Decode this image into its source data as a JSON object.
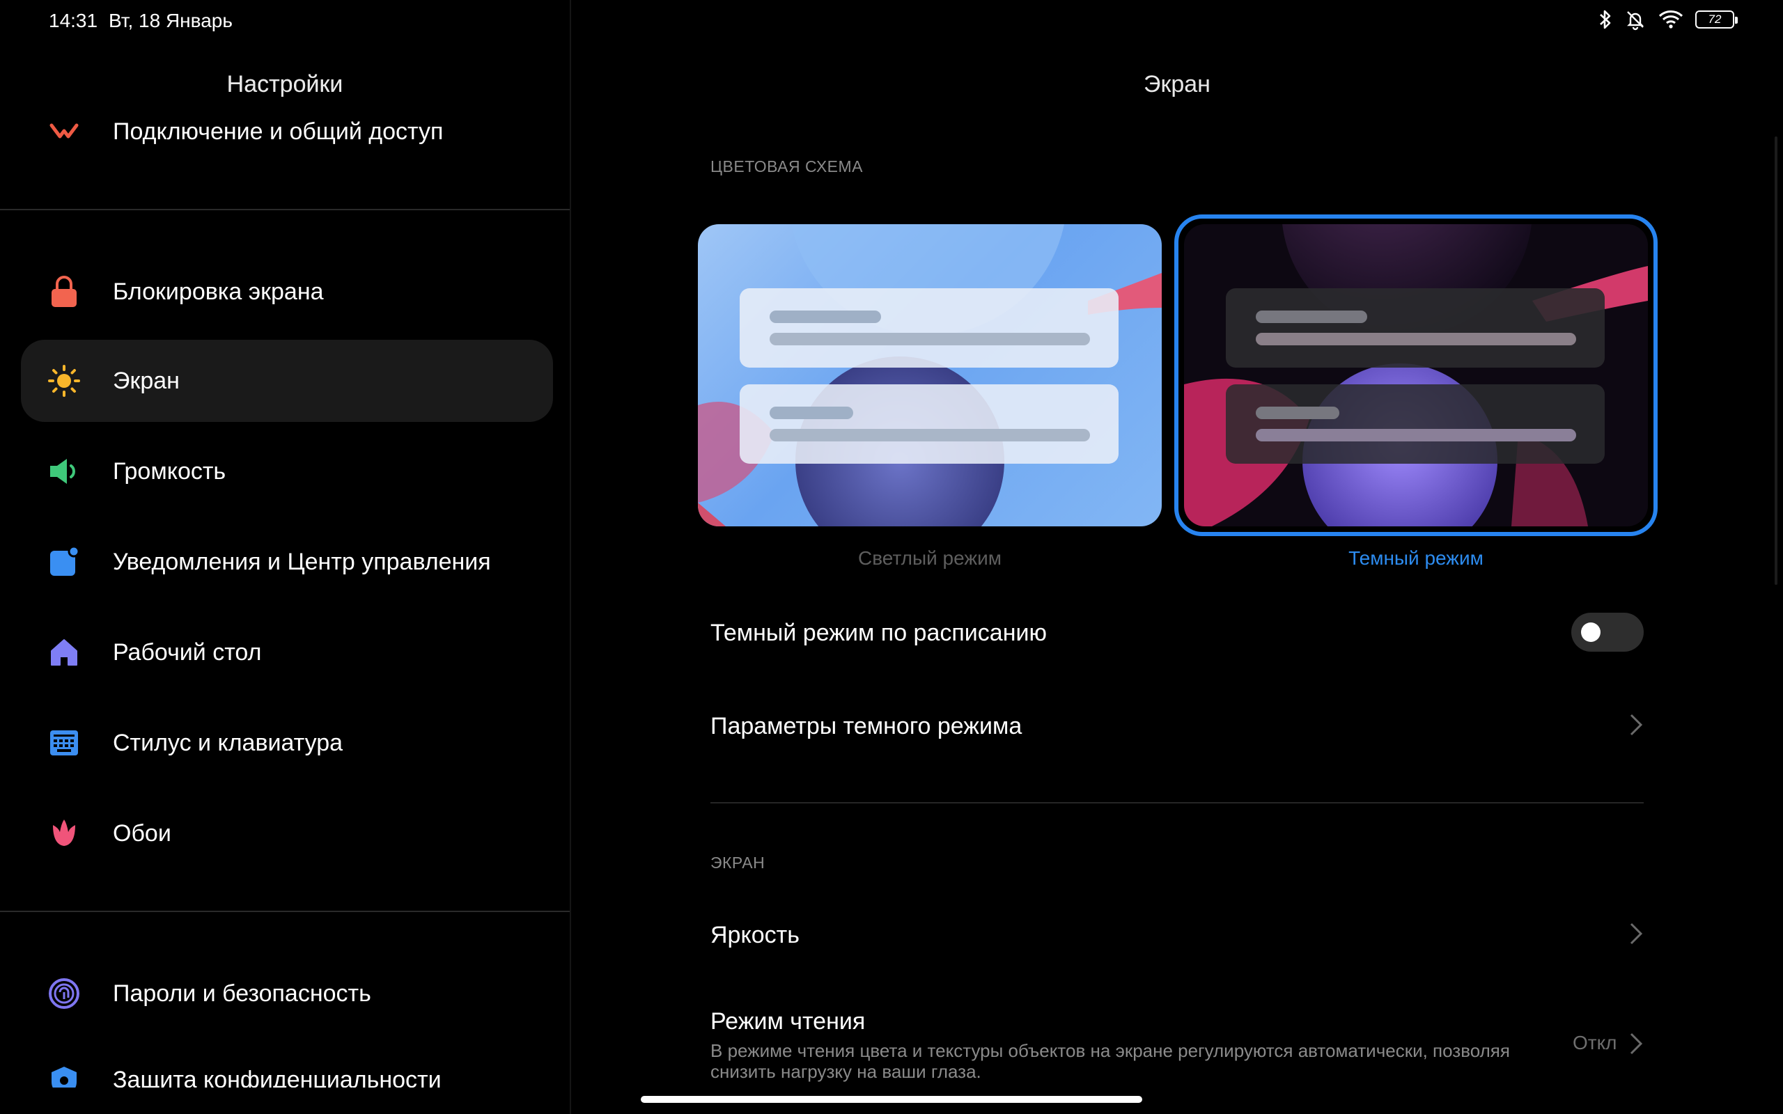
{
  "status_bar": {
    "time": "14:31",
    "date": "Вт, 18 Январь",
    "battery": "72",
    "icons": [
      "bluetooth-icon",
      "bell-muted-icon",
      "wifi-icon",
      "battery-icon"
    ]
  },
  "left": {
    "title": "Настройки",
    "items": [
      {
        "label": "Подключение и общий доступ",
        "icon": "connection-share-icon",
        "color": "#ef5a44"
      },
      {
        "label": "Блокировка экрана",
        "icon": "lock-icon",
        "color": "#f2644f"
      },
      {
        "label": "Экран",
        "icon": "sun-icon",
        "color": "#f8b62b",
        "active": true
      },
      {
        "label": "Громкость",
        "icon": "speaker-icon",
        "color": "#3fc87a"
      },
      {
        "label": "Уведомления и Центр управления",
        "icon": "notification-icon",
        "color": "#3a8ff2"
      },
      {
        "label": "Рабочий стол",
        "icon": "home-icon",
        "color": "#7f7ef5"
      },
      {
        "label": "Стилус и клавиатура",
        "icon": "keyboard-icon",
        "color": "#3c8ef0"
      },
      {
        "label": "Обои",
        "icon": "tulip-icon",
        "color": "#f0547a"
      },
      {
        "label": "Пароли и безопасность",
        "icon": "fingerprint-icon",
        "color": "#7e76f0"
      },
      {
        "label": "Защита конфиденциальности",
        "icon": "privacy-icon",
        "color": "#3a8ff2"
      }
    ]
  },
  "right": {
    "title": "Экран",
    "color_scheme_header": "ЦВЕТОВАЯ СХЕМА",
    "light_mode_label": "Светлый режим",
    "dark_mode_label": "Темный режим",
    "selected_scheme": "dark",
    "scheduled_dark": {
      "label": "Темный режим по расписанию",
      "enabled": false
    },
    "dark_params": {
      "label": "Параметры темного режима"
    },
    "screen_header": "ЭКРАН",
    "brightness": {
      "label": "Яркость"
    },
    "reading_mode": {
      "label": "Режим чтения",
      "description": "В режиме чтения цвета и текстуры объектов на экране регулируются автоматически, позволяя снизить нагрузку на ваши глаза.",
      "value": "Откл"
    }
  },
  "colors": {
    "accent": "#2784f0",
    "background": "#000000"
  }
}
